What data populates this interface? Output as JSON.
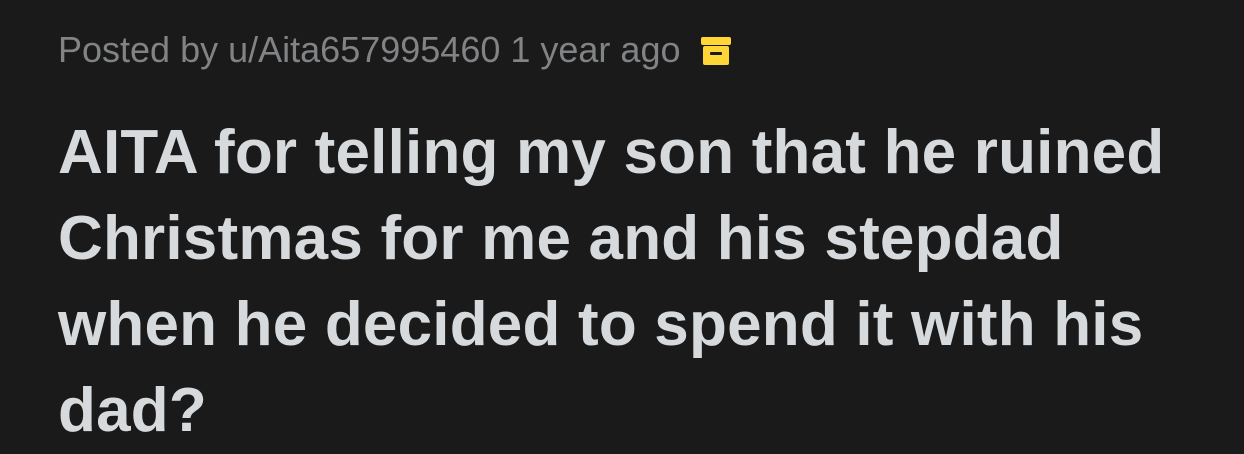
{
  "post": {
    "posted_by_prefix": "Posted by",
    "author": "u/Aita657995460",
    "timestamp": "1 year ago",
    "status_icon": "archive-icon",
    "status_icon_color": "#ffd635",
    "title": "AITA for telling my son that he ruined Christmas for me and his stepdad when he decided to spend it with his dad?"
  }
}
